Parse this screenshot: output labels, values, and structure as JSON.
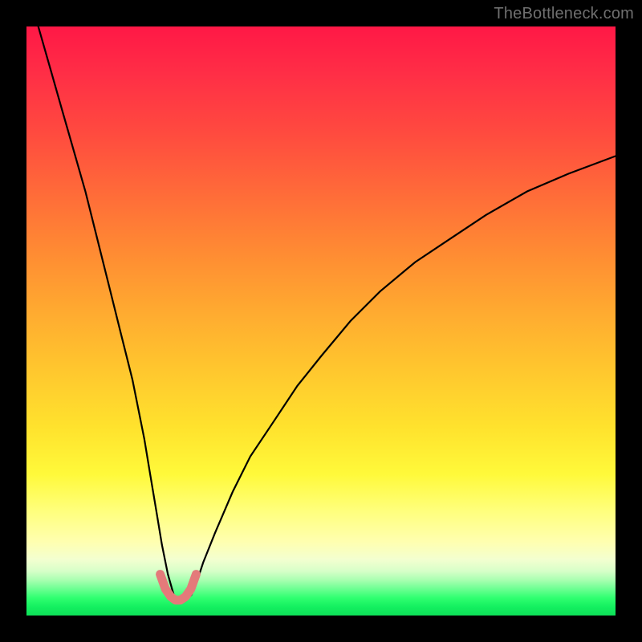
{
  "watermark": "TheBottleneck.com",
  "chart_data": {
    "type": "line",
    "title": "",
    "xlabel": "",
    "ylabel": "",
    "xlim": [
      0,
      100
    ],
    "ylim": [
      0,
      100
    ],
    "series": [
      {
        "name": "bottleneck-curve",
        "x": [
          2,
          4,
          6,
          8,
          10,
          12,
          14,
          16,
          18,
          20,
          21,
          22,
          23,
          24,
          25,
          26,
          27,
          28,
          29,
          30,
          32,
          35,
          38,
          42,
          46,
          50,
          55,
          60,
          66,
          72,
          78,
          85,
          92,
          100
        ],
        "values": [
          100,
          93,
          86,
          79,
          72,
          64,
          56,
          48,
          40,
          30,
          24,
          18,
          12,
          7,
          3.5,
          2.5,
          2.5,
          3.5,
          6,
          9,
          14,
          21,
          27,
          33,
          39,
          44,
          50,
          55,
          60,
          64,
          68,
          72,
          75,
          78
        ]
      }
    ],
    "marker_band": {
      "name": "optimal-range",
      "x": [
        22.7,
        23.6,
        24.5,
        25.3,
        26.1,
        27.0,
        27.9,
        28.8
      ],
      "values": [
        7.0,
        4.5,
        3.2,
        2.6,
        2.6,
        3.2,
        4.5,
        7.0
      ],
      "color": "#e47a7a",
      "stroke_width_px": 11
    },
    "gradient_stops": [
      {
        "pos": 0.0,
        "color": "#ff1846"
      },
      {
        "pos": 0.5,
        "color": "#ffa930"
      },
      {
        "pos": 0.78,
        "color": "#fff93a"
      },
      {
        "pos": 0.92,
        "color": "#d6ffc8"
      },
      {
        "pos": 1.0,
        "color": "#0ee058"
      }
    ]
  }
}
